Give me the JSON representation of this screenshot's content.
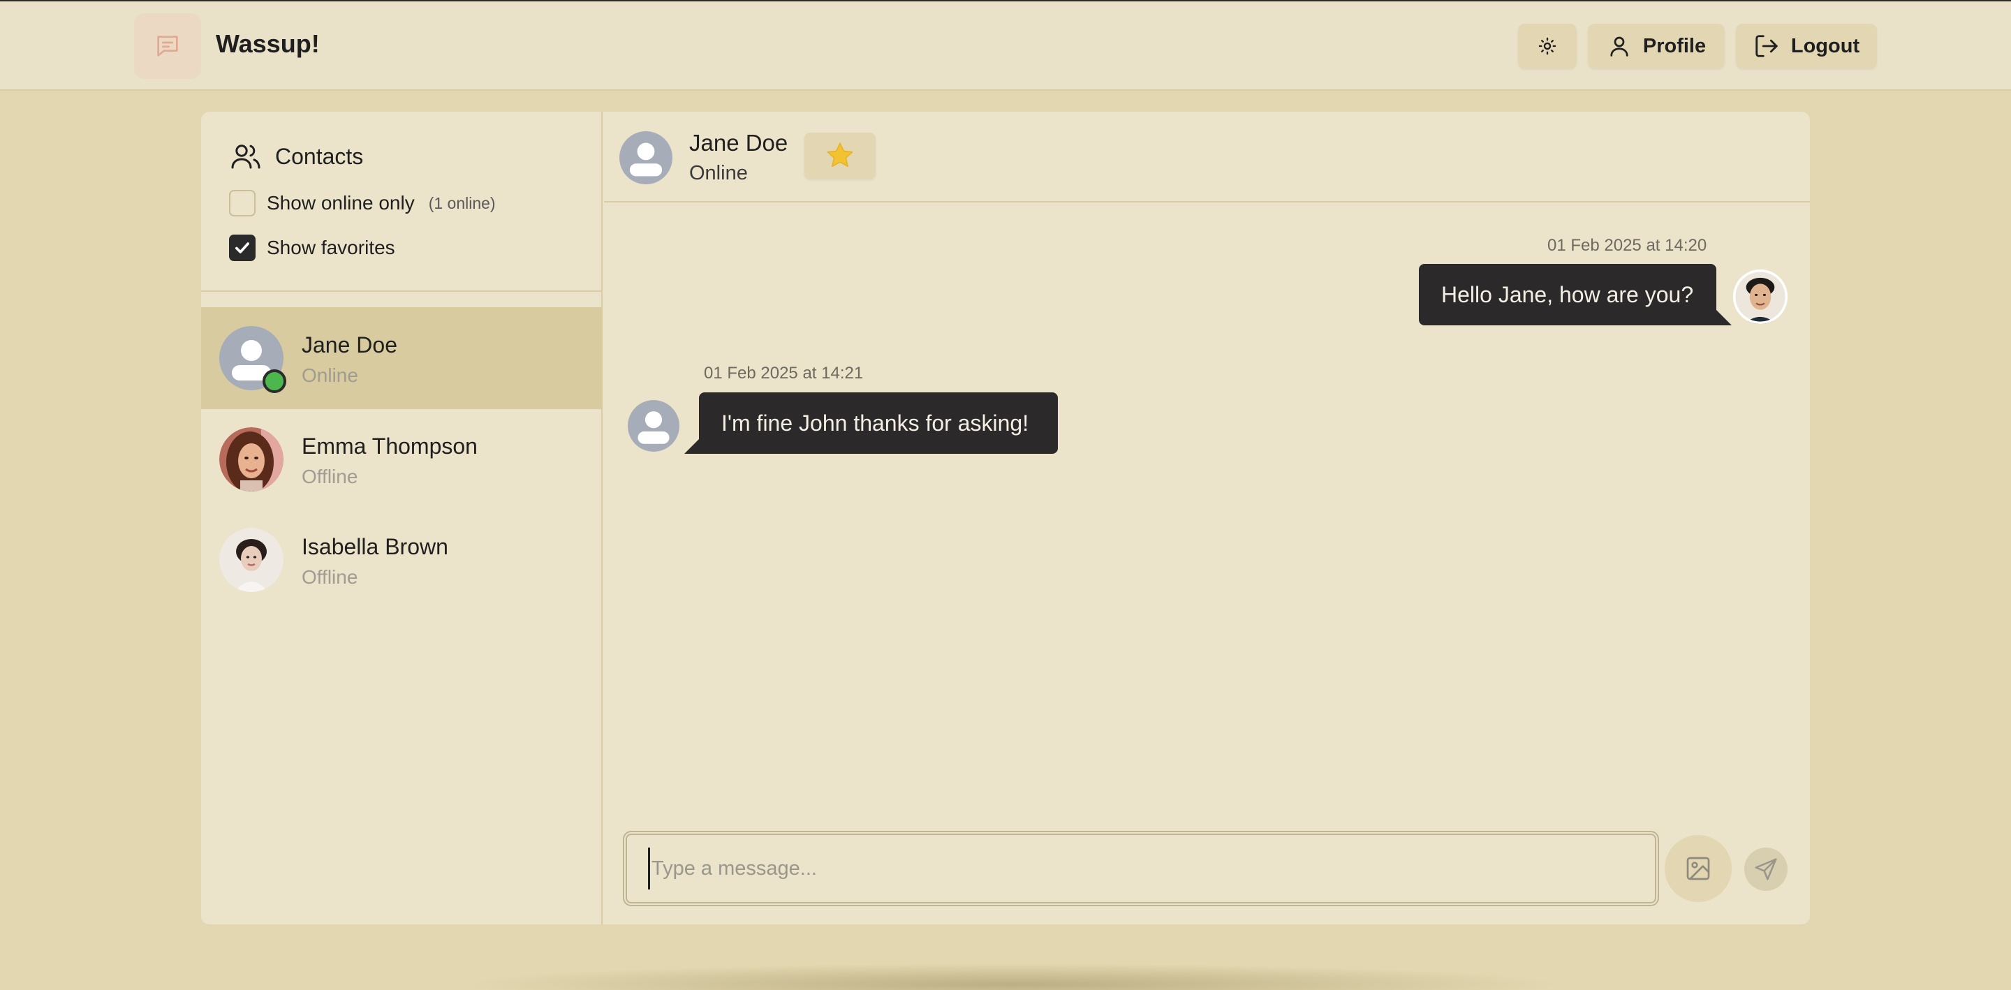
{
  "app": {
    "title": "Wassup!"
  },
  "nav": {
    "theme_icon": "sun-icon",
    "profile_label": "Profile",
    "logout_label": "Logout"
  },
  "sidebar": {
    "title": "Contacts",
    "filters": {
      "online_label": "Show online only",
      "online_checked": false,
      "online_count": "(1 online)",
      "favorites_label": "Show favorites",
      "favorites_checked": true
    },
    "contacts": [
      {
        "name": "Jane Doe",
        "status": "Online",
        "active": true,
        "avatar": "default-avatar-icon"
      },
      {
        "name": "Emma Thompson",
        "status": "Offline",
        "active": false,
        "avatar": "photo"
      },
      {
        "name": "Isabella Brown",
        "status": "Offline",
        "active": false,
        "avatar": "photo"
      }
    ]
  },
  "chat": {
    "name": "Jane Doe",
    "status": "Online",
    "favorite": true,
    "messages": [
      {
        "direction": "outgoing",
        "time": "01 Feb 2025 at 14:20",
        "text": "Hello Jane, how are you?"
      },
      {
        "direction": "incoming",
        "time": "01 Feb 2025 at 14:21",
        "text": "I'm fine John thanks for asking!"
      }
    ],
    "composer": {
      "placeholder": "Type a message...",
      "value": ""
    }
  },
  "colors": {
    "page_bg": "#e2d7b0",
    "panel_bg": "#ebe3ca",
    "active_contact": "#d8cb9f",
    "bubble": "#2b2929",
    "online_dot": "#4cb74c",
    "star": "#f2c230",
    "logo_icon": "#e4a890"
  }
}
